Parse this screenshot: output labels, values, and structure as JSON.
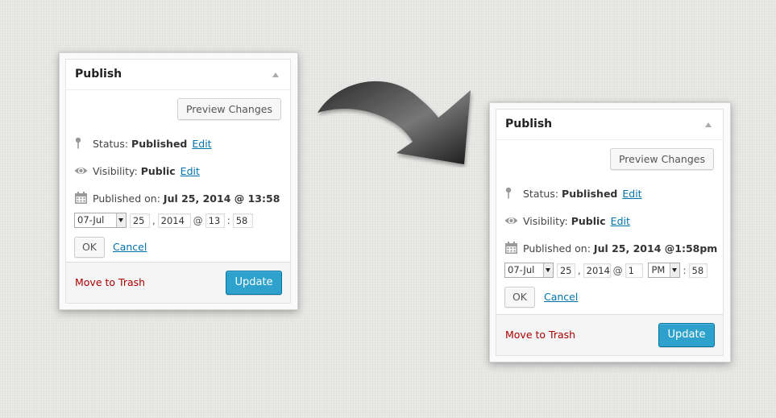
{
  "before": {
    "title": "Publish",
    "preview_label": "Preview Changes",
    "status_label": "Status:",
    "status_value": "Published",
    "status_edit": "Edit",
    "visibility_label": "Visibility:",
    "visibility_value": "Public",
    "visibility_edit": "Edit",
    "published_label": "Published on:",
    "published_value": "Jul 25, 2014 @ 13:58",
    "month_value": "07-Jul",
    "day_value": "25",
    "comma": ",",
    "year_value": "2014",
    "at": "@",
    "hour_value": "13",
    "colon": ":",
    "minute_value": "58",
    "ok_label": "OK",
    "cancel_label": "Cancel",
    "trash_label": "Move to Trash",
    "update_label": "Update"
  },
  "after": {
    "title": "Publish",
    "preview_label": "Preview Changes",
    "status_label": "Status:",
    "status_value": "Published",
    "status_edit": "Edit",
    "visibility_label": "Visibility:",
    "visibility_value": "Public",
    "visibility_edit": "Edit",
    "published_label": "Published on:",
    "published_value": "Jul 25, 2014 @1:58pm",
    "month_value": "07-Jul",
    "day_value": "25",
    "comma": ",",
    "year_value": "2014",
    "at": "@",
    "hour_value": "1",
    "ampm_value": "PM",
    "colon": ":",
    "minute_value": "58",
    "ok_label": "OK",
    "cancel_label": "Cancel",
    "trash_label": "Move to Trash",
    "update_label": "Update"
  },
  "icons": {
    "status": "pin-icon",
    "visibility": "eye-icon",
    "published": "calendar-icon",
    "collapse": "triangle-up-icon",
    "transition": "curved-arrow-icon"
  },
  "colors": {
    "link": "#0073aa",
    "trash": "#aa0000",
    "update_button": "#2ea2cc"
  }
}
